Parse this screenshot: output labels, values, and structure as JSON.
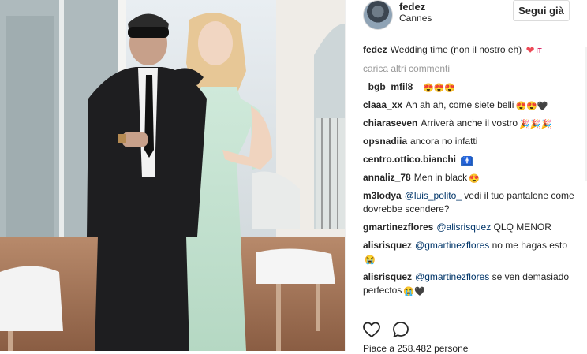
{
  "post": {
    "username": "fedez",
    "location": "Cannes",
    "follow_label": "Segui già",
    "caption_user": "fedez",
    "caption_text": "Wedding time (non il nostro eh)",
    "caption_emoji": "❤",
    "caption_flag": "IT",
    "load_more": "carica altri commenti",
    "likes": "Piace a 258.482 persone"
  },
  "comments": [
    {
      "user": "_bgb_mfil8_",
      "text": "",
      "emoji": "😍😍😍"
    },
    {
      "user": "claaa_xx",
      "text": "Ah ah ah, come siete belli",
      "emoji": "😍😍🖤"
    },
    {
      "user": "chiaraseven",
      "text": "Arriverà anche il vostro",
      "emoji": "🎉🎉🎉"
    },
    {
      "user": "opsnadiia",
      "text": "ancora no infatti",
      "emoji": ""
    },
    {
      "user": "centro.ottico.bianchi",
      "text": "",
      "emoji": "🚹"
    },
    {
      "user": "annaliz_78",
      "text": "Men in black",
      "emoji": "😍"
    },
    {
      "user": "m3lodya",
      "mention": "@luis_polito_",
      "text": "vedi il tuo pantalone come dovrebbe scendere?",
      "emoji": ""
    },
    {
      "user": "gmartinezflores",
      "mention": "@alisrisquez",
      "text": "QLQ MENOR",
      "emoji": ""
    },
    {
      "user": "alisrisquez",
      "mention": "@gmartinezflores",
      "text": "no me hagas esto",
      "emoji": "😭"
    },
    {
      "user": "alisrisquez",
      "mention": "@gmartinezflores",
      "text": "se ven demasiado perfectos",
      "emoji": "😭🖤"
    }
  ],
  "colors": {
    "heart": "#ed4956",
    "link": "#003569",
    "muted": "#999999"
  },
  "icons": {
    "like": "heart-outline-icon",
    "comment": "speech-bubble-icon"
  }
}
